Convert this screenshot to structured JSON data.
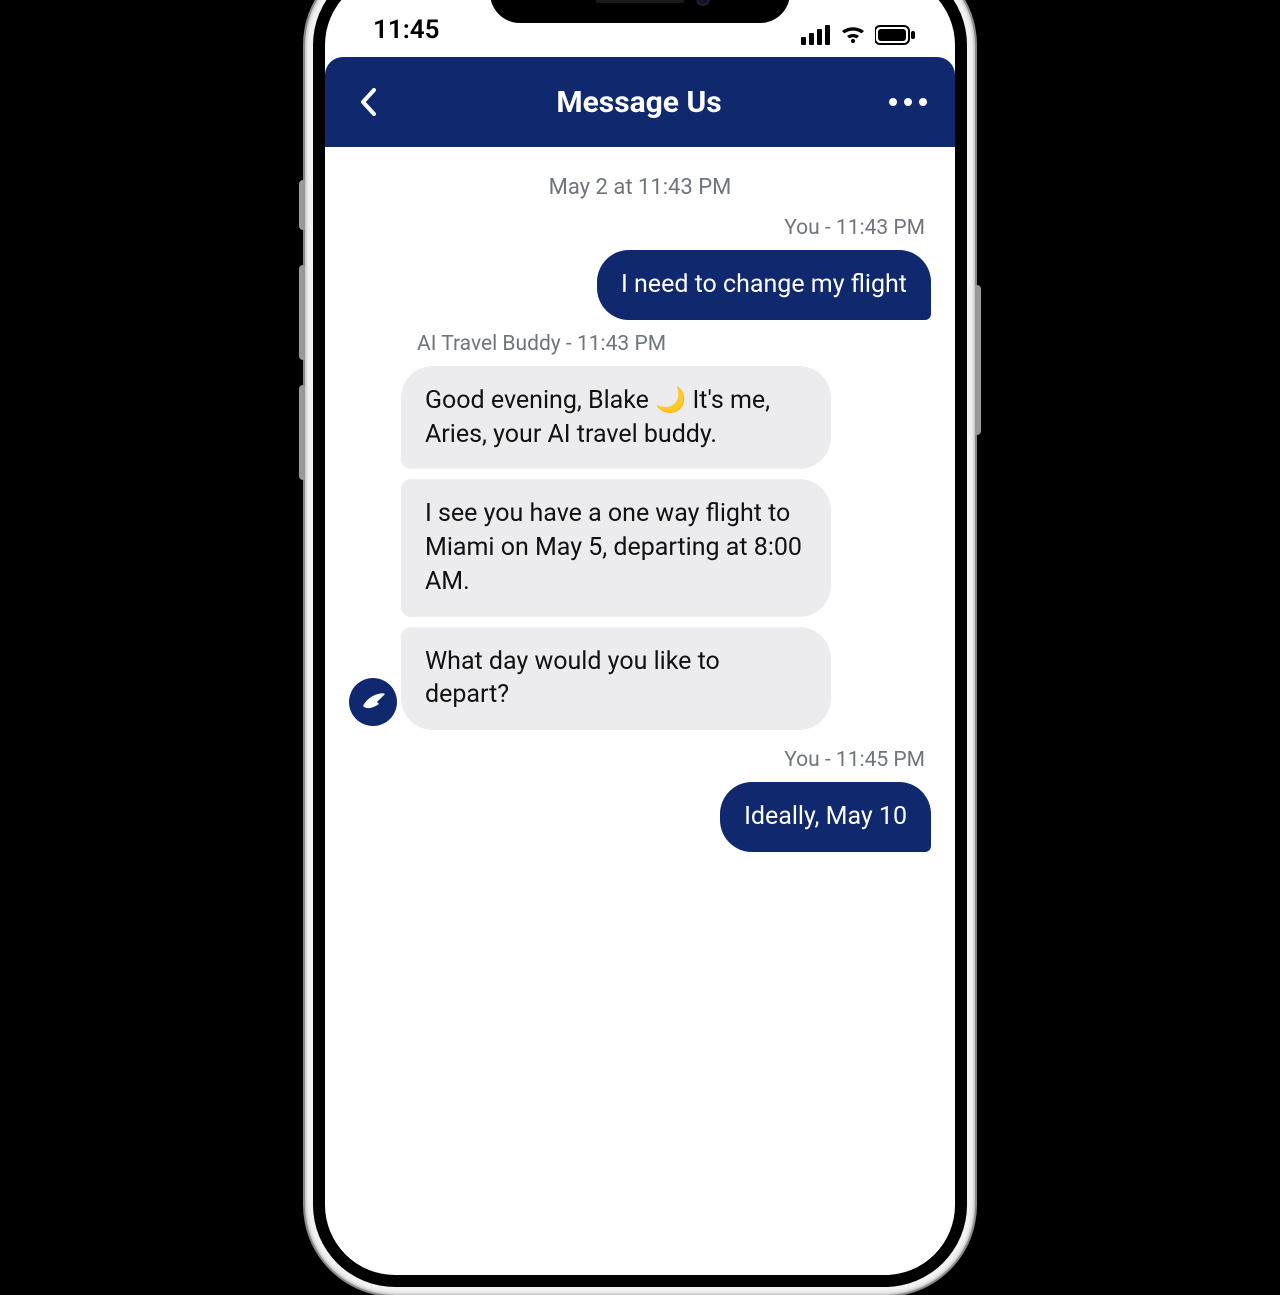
{
  "status": {
    "time": "11:45"
  },
  "header": {
    "title": "Message Us"
  },
  "chat": {
    "date_separator": "May 2 at 11:43 PM",
    "msg1_meta": "You - 11:43 PM",
    "msg1_text": "I need to change my flight",
    "bot_meta": "AI Travel Buddy - 11:43 PM",
    "bot1_pre": "Good evening, Blake ",
    "bot1_post": " It's me, Aries, your AI travel buddy.",
    "bot2": "I see you have a one way flight to Miami on May 5, departing at 8:00 AM.",
    "bot3": "What day would you like to depart?",
    "msg2_meta": "You - 11:45 PM",
    "msg2_text": "Ideally, May 10"
  }
}
